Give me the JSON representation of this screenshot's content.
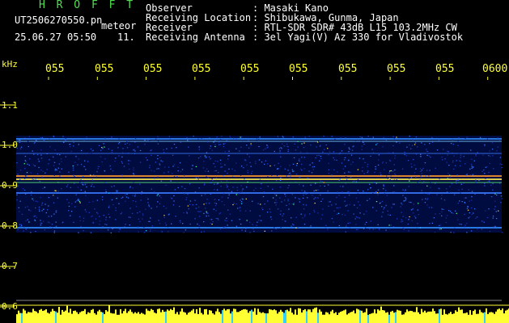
{
  "header": {
    "title": "H R O F F T",
    "file": "UT2506270550.pn",
    "type": "meteor",
    "datetime": "25.06.27 05:50",
    "count": "11.",
    "fields": [
      {
        "label": "Observer",
        "value": ": Masaki Kano"
      },
      {
        "label": "Receiving Location",
        "value": ": Shibukawa, Gunma, Japan"
      },
      {
        "label": "Receiver",
        "value": ": RTL-SDR SDR# 43dB L15 103.2MHz CW"
      },
      {
        "label": "Receiving Antenna",
        "value": ": 3el Yagi(V) Az 330 for Vladivostok"
      }
    ]
  },
  "axis": {
    "unit": "kHz",
    "time_ticks": [
      "055",
      "055",
      "055",
      "055",
      "055",
      "055",
      "055",
      "055",
      "055",
      "0600"
    ],
    "freq_ticks": [
      "1.1",
      "1.0",
      "0.9",
      "0.8",
      "0.7",
      "0.6"
    ]
  },
  "colors": {
    "text_green": "#4ee04e",
    "text_white": "#ffffff",
    "signal_yellow": "#ffff33",
    "noise_blue": "#1030c0"
  }
}
